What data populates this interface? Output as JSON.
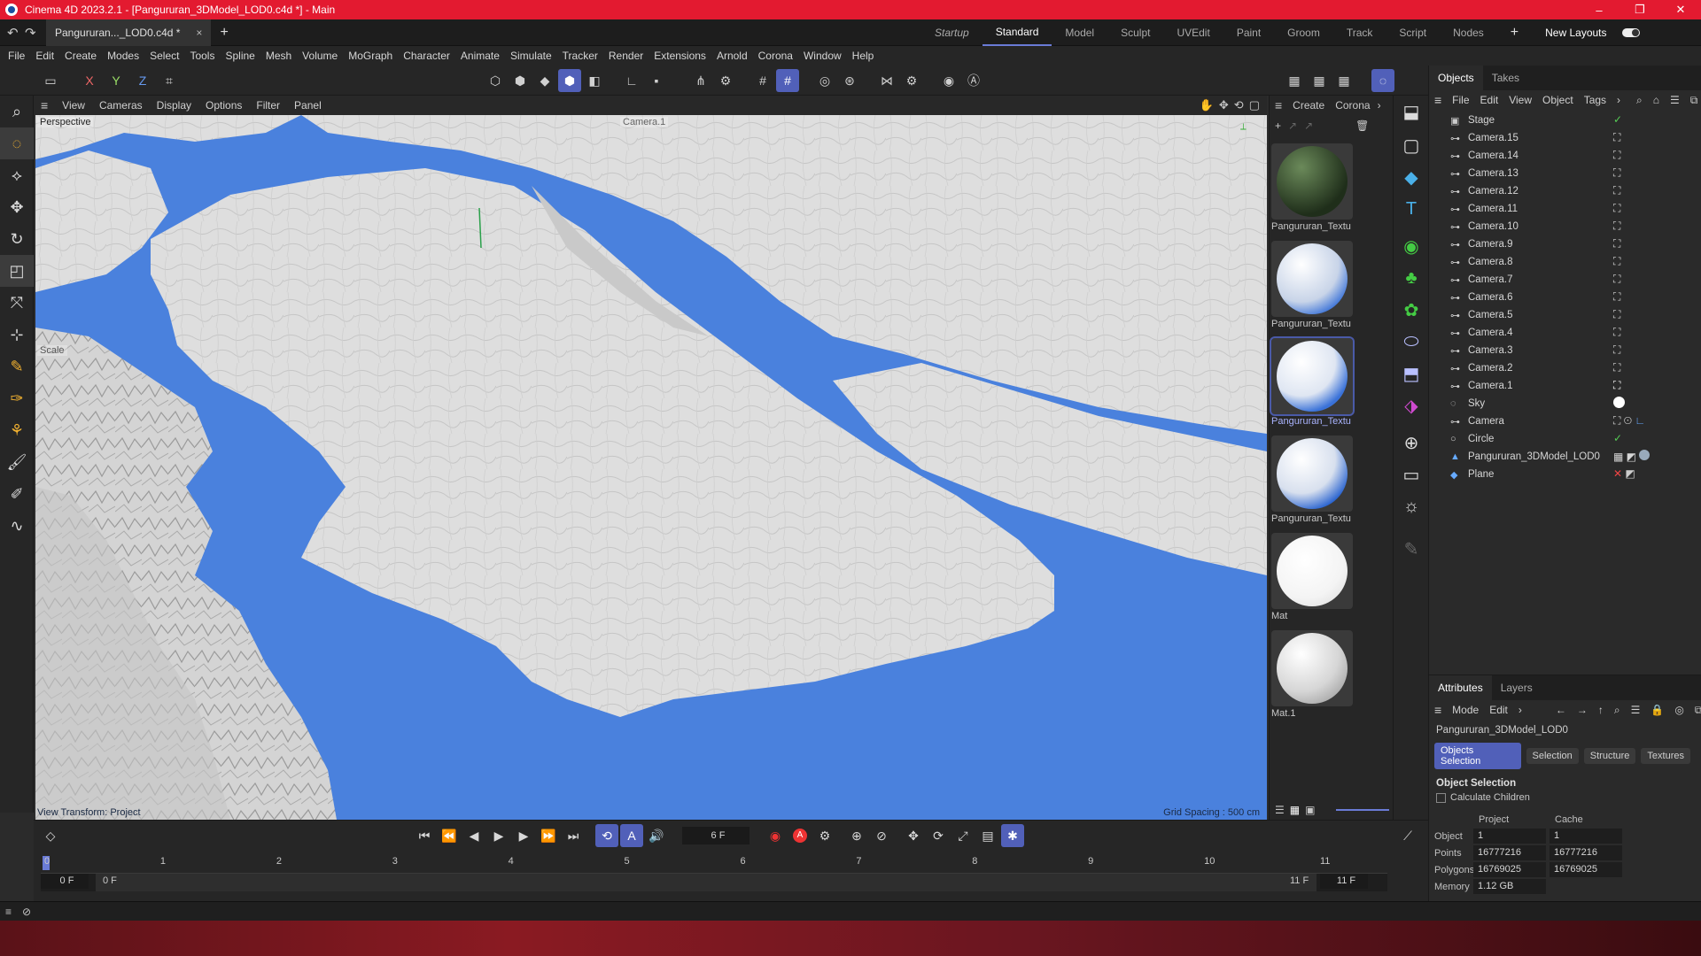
{
  "window": {
    "title": "Cinema 4D 2023.2.1 - [Pangururan_3DModel_LOD0.c4d *] - Main",
    "controls": [
      "–",
      "❐",
      "✕"
    ]
  },
  "document_tab": {
    "label": "Pangururan..._LOD0.c4d *",
    "close": "×",
    "add": "+"
  },
  "layouts": {
    "items": [
      "Startup",
      "Standard",
      "Model",
      "Sculpt",
      "UVEdit",
      "Paint",
      "Groom",
      "Track",
      "Script",
      "Nodes"
    ],
    "active": "Standard",
    "add": "+",
    "new_layouts": "New Layouts"
  },
  "menubar": [
    "File",
    "Edit",
    "Create",
    "Modes",
    "Select",
    "Tools",
    "Spline",
    "Mesh",
    "Volume",
    "MoGraph",
    "Character",
    "Animate",
    "Simulate",
    "Tracker",
    "Render",
    "Extensions",
    "Arnold",
    "Corona",
    "Window",
    "Help"
  ],
  "axes": [
    "X",
    "Y",
    "Z"
  ],
  "viewport": {
    "menu": [
      "View",
      "Cameras",
      "Display",
      "Options",
      "Filter",
      "Panel"
    ],
    "label_view": "Perspective",
    "label_camera": "Camera.1",
    "label_scale": "Scale",
    "label_transform": "View Transform: Project",
    "label_grid": "Grid Spacing : 500 cm",
    "water_color": "#4a81dd",
    "terrain_color": "#dcdcdc"
  },
  "materials": {
    "menu": [
      "Create",
      "Corona"
    ],
    "items": [
      {
        "name": "Pangururan_Textu",
        "style": "dark"
      },
      {
        "name": "Pangururan_Textu",
        "style": "blue"
      },
      {
        "name": "Pangururan_Textu",
        "style": "blue-selected"
      },
      {
        "name": "Pangururan_Textu",
        "style": "blue"
      },
      {
        "name": "Mat",
        "style": "white"
      },
      {
        "name": "Mat.1",
        "style": "grey"
      }
    ]
  },
  "objects_panel": {
    "tabs": [
      "Objects",
      "Takes"
    ],
    "menu": [
      "File",
      "Edit",
      "View",
      "Object",
      "Tags"
    ],
    "rows": [
      {
        "name": "Stage",
        "icon": "stage-icon",
        "tag": "check"
      },
      {
        "name": "Camera.15",
        "icon": "camera-icon",
        "tag": "target"
      },
      {
        "name": "Camera.14",
        "icon": "camera-icon",
        "tag": "target"
      },
      {
        "name": "Camera.13",
        "icon": "camera-icon",
        "tag": "target"
      },
      {
        "name": "Camera.12",
        "icon": "camera-icon",
        "tag": "target"
      },
      {
        "name": "Camera.11",
        "icon": "camera-icon",
        "tag": "target"
      },
      {
        "name": "Camera.10",
        "icon": "camera-icon",
        "tag": "target"
      },
      {
        "name": "Camera.9",
        "icon": "camera-icon",
        "tag": "target"
      },
      {
        "name": "Camera.8",
        "icon": "camera-icon",
        "tag": "target"
      },
      {
        "name": "Camera.7",
        "icon": "camera-icon",
        "tag": "target"
      },
      {
        "name": "Camera.6",
        "icon": "camera-icon",
        "tag": "target"
      },
      {
        "name": "Camera.5",
        "icon": "camera-icon",
        "tag": "target"
      },
      {
        "name": "Camera.4",
        "icon": "camera-icon",
        "tag": "target"
      },
      {
        "name": "Camera.3",
        "icon": "camera-icon",
        "tag": "target"
      },
      {
        "name": "Camera.2",
        "icon": "camera-icon",
        "tag": "target"
      },
      {
        "name": "Camera.1",
        "icon": "camera-icon",
        "tag": "target"
      },
      {
        "name": "Sky",
        "icon": "sky-icon",
        "tag": "sphere"
      },
      {
        "name": "Camera",
        "icon": "camera-icon",
        "tag": "target"
      },
      {
        "name": "Circle",
        "icon": "circle-icon",
        "tag": "check"
      },
      {
        "name": "Pangururan_3DModel_LOD0",
        "icon": "mesh-icon",
        "tag": "material"
      },
      {
        "name": "Plane",
        "icon": "plane-icon",
        "tag": "cross"
      }
    ]
  },
  "attributes": {
    "tabs": [
      "Attributes",
      "Layers"
    ],
    "menu": [
      "Mode",
      "Edit"
    ],
    "object_name": "Pangururan_3DModel_LOD0",
    "subtabs": [
      "Objects Selection",
      "Selection",
      "Structure",
      "Textures"
    ],
    "section": "Object Selection",
    "calculate_children": "Calculate Children",
    "col_project": "Project",
    "col_cache": "Cache",
    "rows": [
      {
        "label": "Object",
        "project": "1",
        "cache": "1"
      },
      {
        "label": "Points",
        "project": "16777216",
        "cache": "16777216"
      },
      {
        "label": "Polygons",
        "project": "16769025",
        "cache": "16769025"
      },
      {
        "label": "Memory",
        "project": "1.12 GB",
        "cache": ""
      }
    ]
  },
  "timeline": {
    "current_frame": "6 F",
    "ticks": [
      "0",
      "1",
      "2",
      "3",
      "4",
      "5",
      "6",
      "7",
      "8",
      "9",
      "10",
      "11"
    ],
    "start": "0 F",
    "min": "0 F",
    "max": "11 F",
    "end": "11 F",
    "playhead_frame": 0
  },
  "colors": {
    "accent": "#5160b9",
    "title_bar": "#e31a30"
  }
}
